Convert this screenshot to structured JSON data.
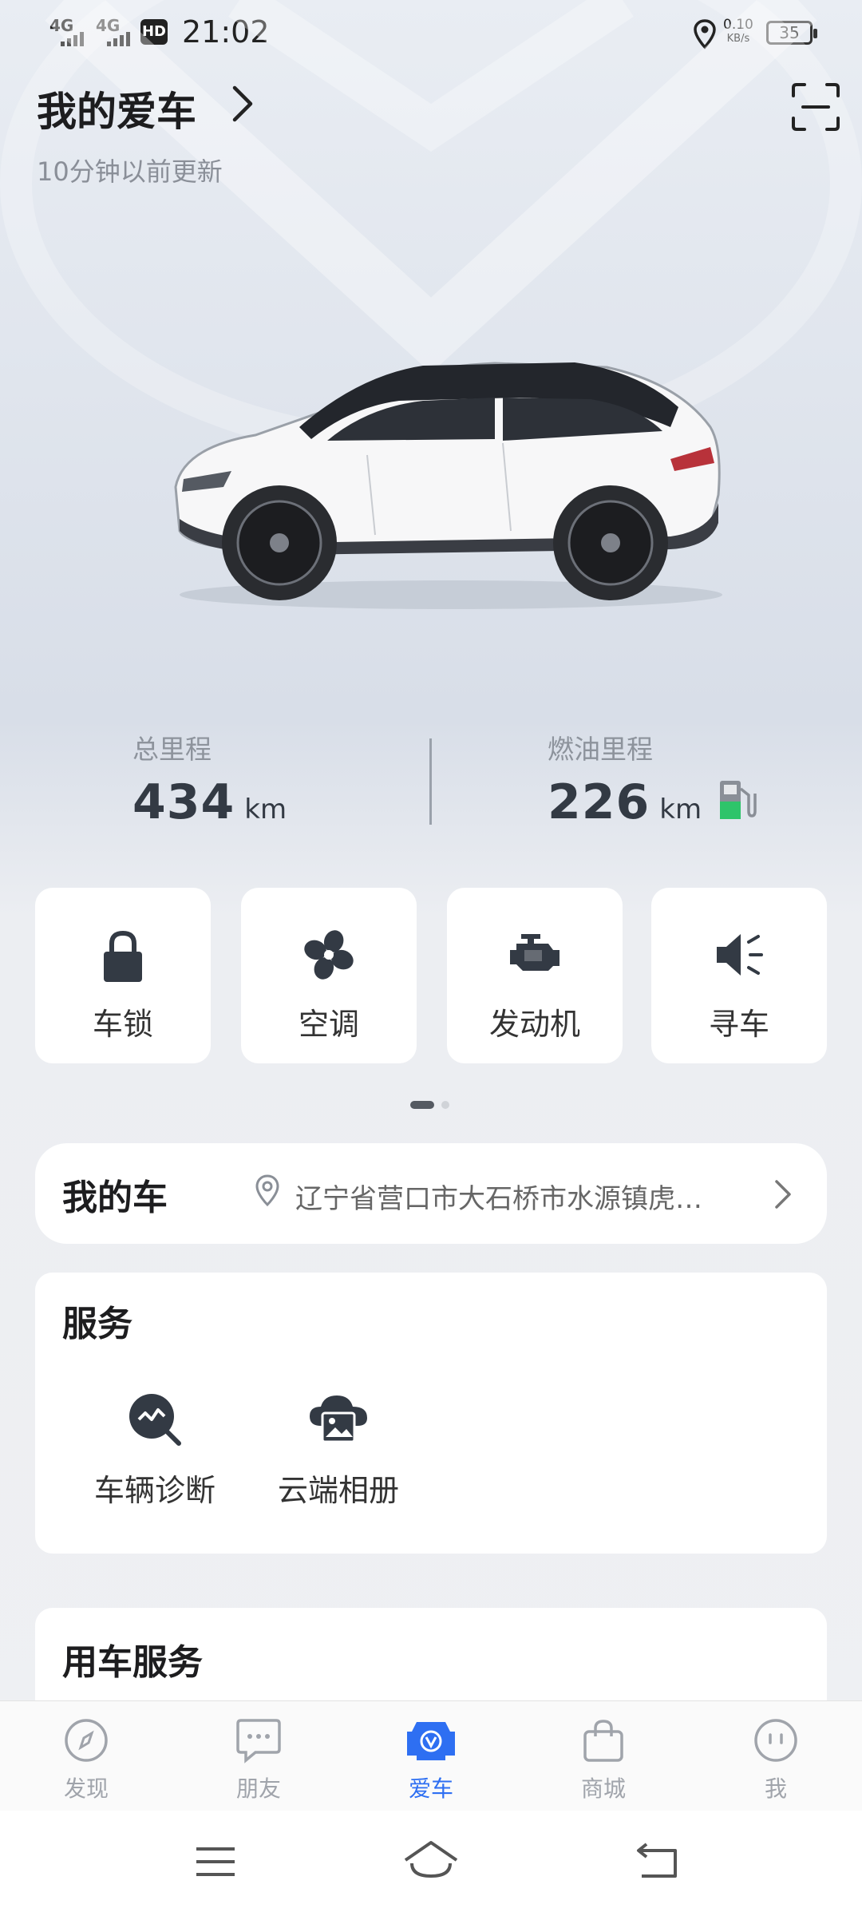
{
  "status_bar": {
    "time": "21:02",
    "signal1": "4G",
    "signal2": "4G",
    "hd": "HD",
    "net_speed_value": "0.10",
    "net_speed_unit": "KB/s",
    "battery": "35"
  },
  "header": {
    "title": "我的爱车",
    "updated": "10分钟以前更新"
  },
  "mileage": {
    "total_label": "总里程",
    "total_value": "434",
    "total_unit": "km",
    "fuel_label": "燃油里程",
    "fuel_value": "226",
    "fuel_unit": "km"
  },
  "controls": [
    {
      "label": "车锁",
      "icon": "lock-icon"
    },
    {
      "label": "空调",
      "icon": "fan-icon"
    },
    {
      "label": "发动机",
      "icon": "engine-icon"
    },
    {
      "label": "寻车",
      "icon": "horn-icon"
    }
  ],
  "pager": {
    "pages": 2,
    "current": 1
  },
  "my_car": {
    "title": "我的车",
    "address": "辽宁省营口市大石桥市水源镇虎…"
  },
  "services": {
    "title": "服务",
    "items": [
      {
        "label": "车辆诊断",
        "icon": "diagnosis-icon"
      },
      {
        "label": "云端相册",
        "icon": "cloud-album-icon"
      }
    ]
  },
  "car_services": {
    "title": "用车服务"
  },
  "tabs": [
    {
      "label": "发现",
      "icon": "compass-icon",
      "active": false
    },
    {
      "label": "朋友",
      "icon": "chat-icon",
      "active": false
    },
    {
      "label": "爱车",
      "icon": "car-icon",
      "active": true
    },
    {
      "label": "商城",
      "icon": "bag-icon",
      "active": false
    },
    {
      "label": "我",
      "icon": "face-icon",
      "active": false
    }
  ],
  "colors": {
    "accent": "#2e6ff2",
    "fuel_green": "#2ec46a"
  }
}
